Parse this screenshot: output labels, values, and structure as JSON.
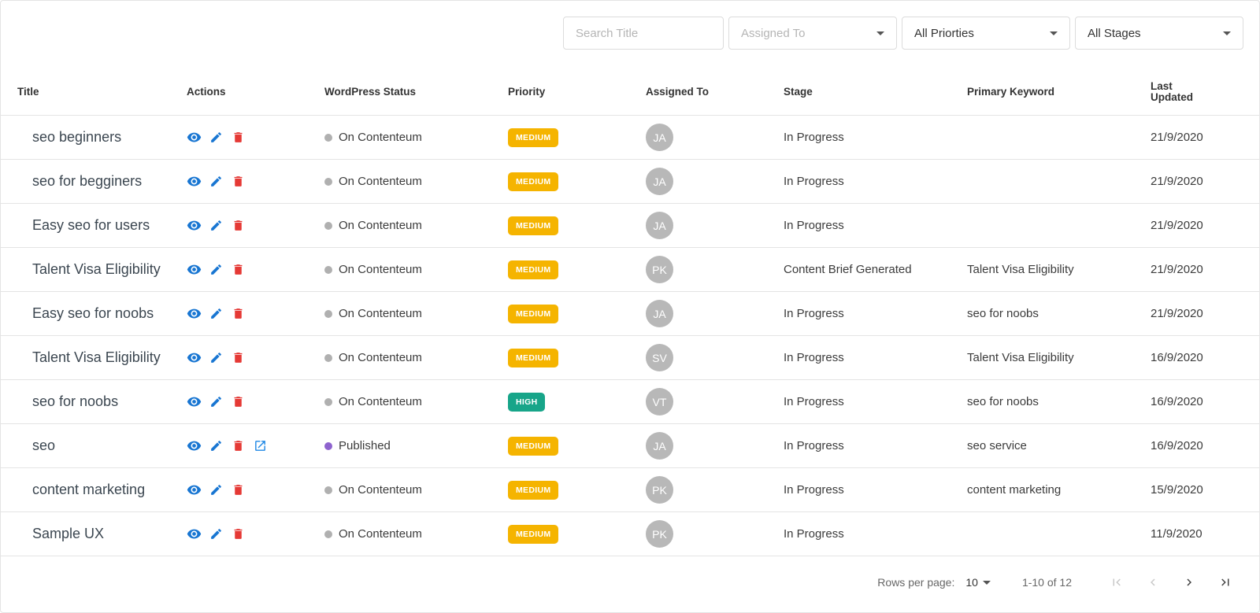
{
  "filters": {
    "search_placeholder": "Search Title",
    "assigned_placeholder": "Assigned To",
    "priority_value": "All Priorties",
    "stage_value": "All Stages"
  },
  "columns": {
    "title": "Title",
    "actions": "Actions",
    "wp_status": "WordPress Status",
    "priority": "Priority",
    "assigned": "Assigned To",
    "stage": "Stage",
    "keyword": "Primary Keyword",
    "updated_line1": "Last",
    "updated_line2": "Updated"
  },
  "colors": {
    "view_icon": "#1976d2",
    "edit_icon": "#1976d2",
    "delete_icon": "#e53935",
    "open_icon": "#1e88e5",
    "status_on_contenteum": "#b0b0b0",
    "status_published": "#8e63ce",
    "priority_medium": "#f5b400",
    "priority_high": "#17a589",
    "avatar_bg": "#b8b8b8"
  },
  "rows": [
    {
      "title": "seo beginners",
      "status": "On Contenteum",
      "priority": "MEDIUM",
      "assignee": "JA",
      "stage": "In Progress",
      "keyword": "",
      "updated": "21/9/2020"
    },
    {
      "title": "seo for begginers",
      "status": "On Contenteum",
      "priority": "MEDIUM",
      "assignee": "JA",
      "stage": "In Progress",
      "keyword": "",
      "updated": "21/9/2020"
    },
    {
      "title": "Easy seo for users",
      "status": "On Contenteum",
      "priority": "MEDIUM",
      "assignee": "JA",
      "stage": "In Progress",
      "keyword": "",
      "updated": "21/9/2020"
    },
    {
      "title": "Talent Visa Eligibility",
      "status": "On Contenteum",
      "priority": "MEDIUM",
      "assignee": "PK",
      "stage": "Content Brief Generated",
      "keyword": "Talent Visa Eligibility",
      "updated": "21/9/2020"
    },
    {
      "title": "Easy seo for noobs",
      "status": "On Contenteum",
      "priority": "MEDIUM",
      "assignee": "JA",
      "stage": "In Progress",
      "keyword": "seo for noobs",
      "updated": "21/9/2020"
    },
    {
      "title": "Talent Visa Eligibility",
      "status": "On Contenteum",
      "priority": "MEDIUM",
      "assignee": "SV",
      "stage": "In Progress",
      "keyword": "Talent Visa Eligibility",
      "updated": "16/9/2020"
    },
    {
      "title": "seo for noobs",
      "status": "On Contenteum",
      "priority": "HIGH",
      "assignee": "VT",
      "stage": "In Progress",
      "keyword": "seo for noobs",
      "updated": "16/9/2020"
    },
    {
      "title": "seo",
      "status": "Published",
      "priority": "MEDIUM",
      "assignee": "JA",
      "stage": "In Progress",
      "keyword": "seo service",
      "updated": "16/9/2020",
      "has_open_link": true
    },
    {
      "title": "content marketing",
      "status": "On Contenteum",
      "priority": "MEDIUM",
      "assignee": "PK",
      "stage": "In Progress",
      "keyword": "content marketing",
      "updated": "15/9/2020"
    },
    {
      "title": "Sample UX",
      "status": "On Contenteum",
      "priority": "MEDIUM",
      "assignee": "PK",
      "stage": "In Progress",
      "keyword": "",
      "updated": "11/9/2020"
    }
  ],
  "pagination": {
    "rows_per_page_label": "Rows per page:",
    "rows_per_page_value": "10",
    "range": "1-10 of 12"
  },
  "icons": [
    "eye-icon",
    "pencil-icon",
    "trash-icon",
    "external-link-icon",
    "chevron-down-icon",
    "first-page-icon",
    "prev-page-icon",
    "next-page-icon",
    "last-page-icon"
  ]
}
